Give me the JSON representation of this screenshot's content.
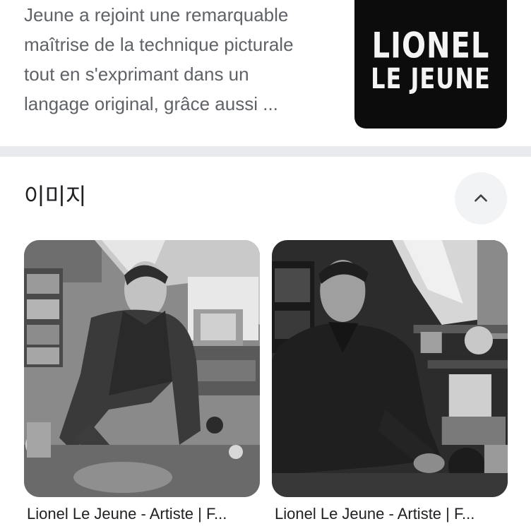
{
  "result": {
    "snippet_lines": [
      "Jeune a rejoint une remarquable",
      "maîtrise de la technique picturale",
      "tout en s'exprimant dans un",
      "langage original, grâce aussi ..."
    ],
    "logo": {
      "line1": "LIONEL",
      "line2": "LE JEUNE"
    }
  },
  "images_section": {
    "title": "이미지",
    "collapse_icon": "chevron-up-icon",
    "items": [
      {
        "caption": "Lionel Le Jeune - Artiste | F..."
      },
      {
        "caption": "Lionel Le Jeune - Artiste | F..."
      }
    ]
  },
  "colors": {
    "snippet_text": "#5f6368",
    "title_text": "#202124",
    "divider": "#e8eaed",
    "button_bg": "#f1f3f4",
    "logo_bg": "#0c0c0c"
  }
}
